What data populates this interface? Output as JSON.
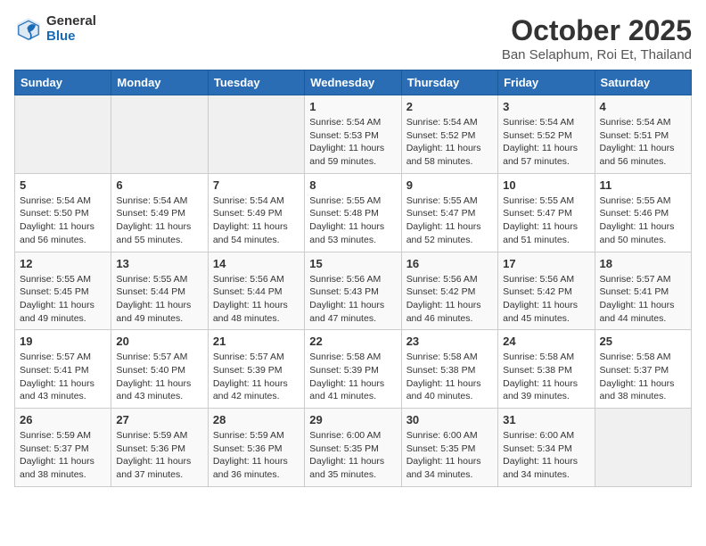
{
  "header": {
    "logo_general": "General",
    "logo_blue": "Blue",
    "month": "October 2025",
    "location": "Ban Selaphum, Roi Et, Thailand"
  },
  "weekdays": [
    "Sunday",
    "Monday",
    "Tuesday",
    "Wednesday",
    "Thursday",
    "Friday",
    "Saturday"
  ],
  "weeks": [
    [
      {
        "day": "",
        "sunrise": "",
        "sunset": "",
        "daylight": ""
      },
      {
        "day": "",
        "sunrise": "",
        "sunset": "",
        "daylight": ""
      },
      {
        "day": "",
        "sunrise": "",
        "sunset": "",
        "daylight": ""
      },
      {
        "day": "1",
        "sunrise": "Sunrise: 5:54 AM",
        "sunset": "Sunset: 5:53 PM",
        "daylight": "Daylight: 11 hours and 59 minutes."
      },
      {
        "day": "2",
        "sunrise": "Sunrise: 5:54 AM",
        "sunset": "Sunset: 5:52 PM",
        "daylight": "Daylight: 11 hours and 58 minutes."
      },
      {
        "day": "3",
        "sunrise": "Sunrise: 5:54 AM",
        "sunset": "Sunset: 5:52 PM",
        "daylight": "Daylight: 11 hours and 57 minutes."
      },
      {
        "day": "4",
        "sunrise": "Sunrise: 5:54 AM",
        "sunset": "Sunset: 5:51 PM",
        "daylight": "Daylight: 11 hours and 56 minutes."
      }
    ],
    [
      {
        "day": "5",
        "sunrise": "Sunrise: 5:54 AM",
        "sunset": "Sunset: 5:50 PM",
        "daylight": "Daylight: 11 hours and 56 minutes."
      },
      {
        "day": "6",
        "sunrise": "Sunrise: 5:54 AM",
        "sunset": "Sunset: 5:49 PM",
        "daylight": "Daylight: 11 hours and 55 minutes."
      },
      {
        "day": "7",
        "sunrise": "Sunrise: 5:54 AM",
        "sunset": "Sunset: 5:49 PM",
        "daylight": "Daylight: 11 hours and 54 minutes."
      },
      {
        "day": "8",
        "sunrise": "Sunrise: 5:55 AM",
        "sunset": "Sunset: 5:48 PM",
        "daylight": "Daylight: 11 hours and 53 minutes."
      },
      {
        "day": "9",
        "sunrise": "Sunrise: 5:55 AM",
        "sunset": "Sunset: 5:47 PM",
        "daylight": "Daylight: 11 hours and 52 minutes."
      },
      {
        "day": "10",
        "sunrise": "Sunrise: 5:55 AM",
        "sunset": "Sunset: 5:47 PM",
        "daylight": "Daylight: 11 hours and 51 minutes."
      },
      {
        "day": "11",
        "sunrise": "Sunrise: 5:55 AM",
        "sunset": "Sunset: 5:46 PM",
        "daylight": "Daylight: 11 hours and 50 minutes."
      }
    ],
    [
      {
        "day": "12",
        "sunrise": "Sunrise: 5:55 AM",
        "sunset": "Sunset: 5:45 PM",
        "daylight": "Daylight: 11 hours and 49 minutes."
      },
      {
        "day": "13",
        "sunrise": "Sunrise: 5:55 AM",
        "sunset": "Sunset: 5:44 PM",
        "daylight": "Daylight: 11 hours and 49 minutes."
      },
      {
        "day": "14",
        "sunrise": "Sunrise: 5:56 AM",
        "sunset": "Sunset: 5:44 PM",
        "daylight": "Daylight: 11 hours and 48 minutes."
      },
      {
        "day": "15",
        "sunrise": "Sunrise: 5:56 AM",
        "sunset": "Sunset: 5:43 PM",
        "daylight": "Daylight: 11 hours and 47 minutes."
      },
      {
        "day": "16",
        "sunrise": "Sunrise: 5:56 AM",
        "sunset": "Sunset: 5:42 PM",
        "daylight": "Daylight: 11 hours and 46 minutes."
      },
      {
        "day": "17",
        "sunrise": "Sunrise: 5:56 AM",
        "sunset": "Sunset: 5:42 PM",
        "daylight": "Daylight: 11 hours and 45 minutes."
      },
      {
        "day": "18",
        "sunrise": "Sunrise: 5:57 AM",
        "sunset": "Sunset: 5:41 PM",
        "daylight": "Daylight: 11 hours and 44 minutes."
      }
    ],
    [
      {
        "day": "19",
        "sunrise": "Sunrise: 5:57 AM",
        "sunset": "Sunset: 5:41 PM",
        "daylight": "Daylight: 11 hours and 43 minutes."
      },
      {
        "day": "20",
        "sunrise": "Sunrise: 5:57 AM",
        "sunset": "Sunset: 5:40 PM",
        "daylight": "Daylight: 11 hours and 43 minutes."
      },
      {
        "day": "21",
        "sunrise": "Sunrise: 5:57 AM",
        "sunset": "Sunset: 5:39 PM",
        "daylight": "Daylight: 11 hours and 42 minutes."
      },
      {
        "day": "22",
        "sunrise": "Sunrise: 5:58 AM",
        "sunset": "Sunset: 5:39 PM",
        "daylight": "Daylight: 11 hours and 41 minutes."
      },
      {
        "day": "23",
        "sunrise": "Sunrise: 5:58 AM",
        "sunset": "Sunset: 5:38 PM",
        "daylight": "Daylight: 11 hours and 40 minutes."
      },
      {
        "day": "24",
        "sunrise": "Sunrise: 5:58 AM",
        "sunset": "Sunset: 5:38 PM",
        "daylight": "Daylight: 11 hours and 39 minutes."
      },
      {
        "day": "25",
        "sunrise": "Sunrise: 5:58 AM",
        "sunset": "Sunset: 5:37 PM",
        "daylight": "Daylight: 11 hours and 38 minutes."
      }
    ],
    [
      {
        "day": "26",
        "sunrise": "Sunrise: 5:59 AM",
        "sunset": "Sunset: 5:37 PM",
        "daylight": "Daylight: 11 hours and 38 minutes."
      },
      {
        "day": "27",
        "sunrise": "Sunrise: 5:59 AM",
        "sunset": "Sunset: 5:36 PM",
        "daylight": "Daylight: 11 hours and 37 minutes."
      },
      {
        "day": "28",
        "sunrise": "Sunrise: 5:59 AM",
        "sunset": "Sunset: 5:36 PM",
        "daylight": "Daylight: 11 hours and 36 minutes."
      },
      {
        "day": "29",
        "sunrise": "Sunrise: 6:00 AM",
        "sunset": "Sunset: 5:35 PM",
        "daylight": "Daylight: 11 hours and 35 minutes."
      },
      {
        "day": "30",
        "sunrise": "Sunrise: 6:00 AM",
        "sunset": "Sunset: 5:35 PM",
        "daylight": "Daylight: 11 hours and 34 minutes."
      },
      {
        "day": "31",
        "sunrise": "Sunrise: 6:00 AM",
        "sunset": "Sunset: 5:34 PM",
        "daylight": "Daylight: 11 hours and 34 minutes."
      },
      {
        "day": "",
        "sunrise": "",
        "sunset": "",
        "daylight": ""
      }
    ]
  ]
}
